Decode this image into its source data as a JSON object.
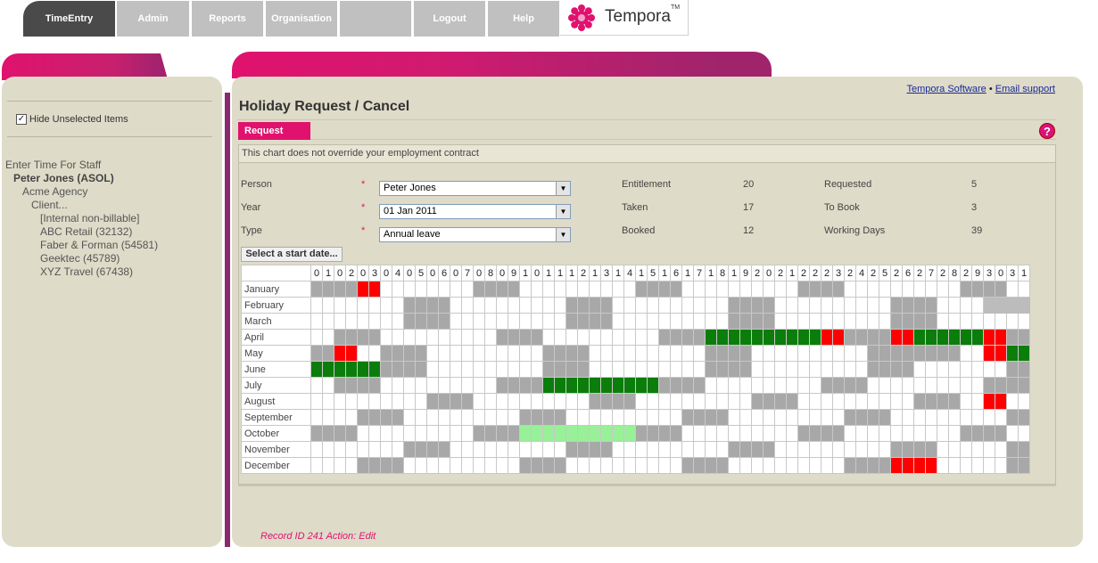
{
  "nav": {
    "tabs": [
      {
        "label": "TimeEntry",
        "active": true
      },
      {
        "label": "Admin",
        "active": false
      },
      {
        "label": "Reports",
        "active": false
      },
      {
        "label": "Organisation",
        "active": false
      },
      {
        "label": "",
        "active": false
      },
      {
        "label": "Logout",
        "active": false
      },
      {
        "label": "Help",
        "active": false
      }
    ],
    "logo_text": "Tempora",
    "logo_tm": "TM"
  },
  "sidebar": {
    "hide_unselected_label": "Hide Unselected Items",
    "hide_unselected_checked": true,
    "tree": [
      {
        "label": "Enter Time For Staff",
        "level": 0,
        "bold": false
      },
      {
        "label": "Peter Jones (ASOL)",
        "level": 1,
        "bold": true
      },
      {
        "label": "Acme Agency",
        "level": 2,
        "bold": false
      },
      {
        "label": "Client...",
        "level": 3,
        "bold": false
      },
      {
        "label": "[Internal non-billable]",
        "level": 4,
        "bold": false
      },
      {
        "label": "ABC Retail (32132)",
        "level": 4,
        "bold": false
      },
      {
        "label": "Faber & Forman (54581)",
        "level": 4,
        "bold": false
      },
      {
        "label": "Geektec (45789)",
        "level": 4,
        "bold": false
      },
      {
        "label": "XYZ Travel (67438)",
        "level": 4,
        "bold": false
      }
    ]
  },
  "links": {
    "software": "Tempora Software",
    "separator": "•",
    "support": "Email support"
  },
  "page_title": "Holiday Request / Cancel",
  "request_tab": "Request",
  "help_glyph": "?",
  "notice": "This chart does not override your employment contract",
  "form": {
    "person_label": "Person",
    "person_value": "Peter Jones",
    "year_label": "Year",
    "year_value": "01 Jan 2011",
    "type_label": "Type",
    "type_value": "Annual leave",
    "required_mark": "*",
    "start_button": "Select a start date..."
  },
  "stats": {
    "entitlement_label": "Entitlement",
    "entitlement": "20",
    "taken_label": "Taken",
    "taken": "17",
    "booked_label": "Booked",
    "booked": "12",
    "requested_label": "Requested",
    "requested": "5",
    "tobook_label": "To Book",
    "tobook": "3",
    "working_label": "Working Days",
    "working": "39"
  },
  "calendar": {
    "day_headers": [
      "0",
      "1",
      "0",
      "2",
      "0",
      "3",
      "0",
      "4",
      "0",
      "5",
      "0",
      "6",
      "0",
      "7",
      "0",
      "8",
      "0",
      "9",
      "1",
      "0",
      "1",
      "1",
      "1",
      "2",
      "1",
      "3",
      "1",
      "4",
      "1",
      "5",
      "1",
      "6",
      "1",
      "7",
      "1",
      "8",
      "1",
      "9",
      "2",
      "0",
      "2",
      "1",
      "2",
      "2",
      "2",
      "3",
      "2",
      "4",
      "2",
      "5",
      "2",
      "6",
      "2",
      "7",
      "2",
      "8",
      "2",
      "9",
      "3",
      "0",
      "3",
      "1"
    ],
    "months": [
      {
        "name": "January",
        "cells": "wwwrrw..........www.....www...........................www......www....www................................wwww..."
      },
      {
        "name": "February",
        "cells": "........wwww.......wwww......w...................wwww.....wwww....................xx"
      },
      {
        "name": "March",
        "cells": "........wwww.......wwww.............................wwww.....wwww...."
      },
      {
        "name": "April",
        "cells": "...."
      },
      {
        "name": "May",
        "cells": "...."
      },
      {
        "name": "June",
        "cells": "...."
      },
      {
        "name": "July",
        "cells": "...."
      },
      {
        "name": "August",
        "cells": "...."
      },
      {
        "name": "September",
        "cells": "...."
      },
      {
        "name": "October",
        "cells": "...."
      },
      {
        "name": "November",
        "cells": "...."
      },
      {
        "name": "December",
        "cells": "...."
      }
    ]
  },
  "colors": {
    "accent": "#e0126e",
    "weekend": "#a8a8a8",
    "booked": "#0b7d0b",
    "requested": "#ff0000",
    "pending": "#98f098"
  },
  "record": "Record ID 241  Action:  Edit"
}
